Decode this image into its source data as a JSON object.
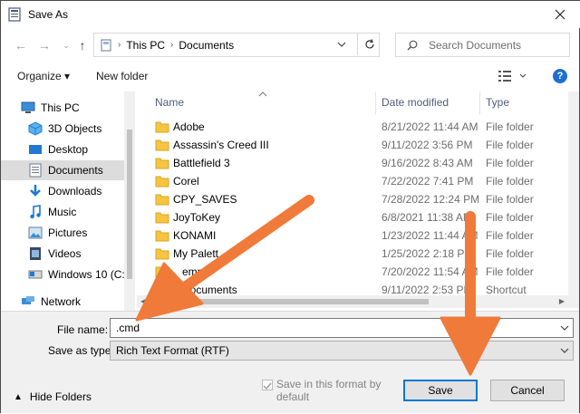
{
  "window": {
    "title": "Save As",
    "close_icon": "close-icon"
  },
  "address": {
    "crumbs": [
      "This PC",
      "Documents"
    ]
  },
  "search": {
    "placeholder": "Search Documents"
  },
  "toolbar": {
    "organize": "Organize ▾",
    "new_folder": "New folder",
    "help": "?"
  },
  "nav": [
    {
      "label": "This PC",
      "icon": "pc-icon"
    },
    {
      "label": "3D Objects",
      "icon": "cube-icon"
    },
    {
      "label": "Desktop",
      "icon": "desktop-icon"
    },
    {
      "label": "Documents",
      "icon": "document-icon",
      "selected": true
    },
    {
      "label": "Downloads",
      "icon": "download-icon"
    },
    {
      "label": "Music",
      "icon": "music-icon"
    },
    {
      "label": "Pictures",
      "icon": "picture-icon"
    },
    {
      "label": "Videos",
      "icon": "video-icon"
    },
    {
      "label": "Windows 10 (C:)",
      "icon": "drive-icon"
    },
    {
      "label": "Network",
      "icon": "network-icon"
    }
  ],
  "columns": {
    "name": "Name",
    "date": "Date modified",
    "type": "Type"
  },
  "files": [
    {
      "name": "Adobe",
      "date": "8/21/2022 11:44 AM",
      "type": "File folder"
    },
    {
      "name": "Assassin's Creed III",
      "date": "9/11/2022 3:56 PM",
      "type": "File folder"
    },
    {
      "name": "Battlefield 3",
      "date": "9/16/2022 8:43 AM",
      "type": "File folder"
    },
    {
      "name": "Corel",
      "date": "7/22/2022 7:41 PM",
      "type": "File folder"
    },
    {
      "name": "CPY_SAVES",
      "date": "7/28/2022 12:24 PM",
      "type": "File folder"
    },
    {
      "name": "JoyToKey",
      "date": "6/8/2021 11:38 AM",
      "type": "File folder"
    },
    {
      "name": "KONAMI",
      "date": "1/23/2022 11:44 AM",
      "type": "File folder"
    },
    {
      "name": "My Palett",
      "date": "1/25/2022 2:18 PM",
      "type": "File folder"
    },
    {
      "name": "emp",
      "date": "7/20/2022 11:54 AM",
      "type": "File folder"
    },
    {
      "name": "Documents",
      "date": "9/11/2022 2:53 PM",
      "type": "Shortcut"
    }
  ],
  "form": {
    "file_name_label": "File name:",
    "file_name_value": ".cmd",
    "save_type_label": "Save as type:",
    "save_type_value": "Rich Text Format (RTF)",
    "checkbox_label": "Save in this format by default",
    "hide_folders": "Hide Folders",
    "save": "Save",
    "cancel": "Cancel"
  },
  "colors": {
    "accent": "#0078d7",
    "arrow": "#f07a3a",
    "folder": "#f5c542"
  }
}
